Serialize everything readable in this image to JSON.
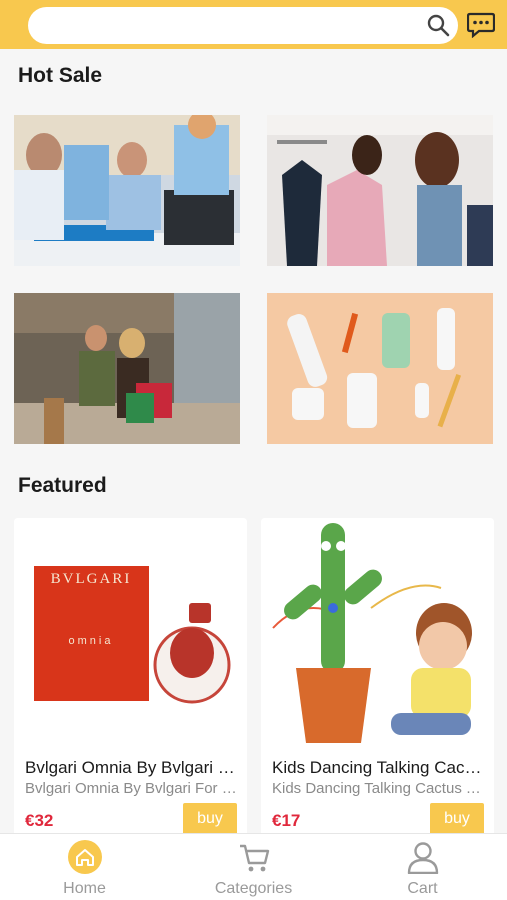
{
  "colors": {
    "accent": "#f8c84e",
    "price": "#e0283c",
    "tab_inactive": "#9a9a9a"
  },
  "search": {
    "value": "",
    "placeholder": ""
  },
  "header": {
    "search_icon": "search-icon",
    "chat_icon": "chat-icon"
  },
  "hot_sale": {
    "title": "Hot Sale",
    "tiles": [
      {
        "subject": "electronics"
      },
      {
        "subject": "fashion"
      },
      {
        "subject": "shopping"
      },
      {
        "subject": "personal-care"
      }
    ]
  },
  "featured": {
    "title": "Featured",
    "products": [
      {
        "name": "Bvlgari Omnia By Bvlgari For Women",
        "subtitle": "Bvlgari Omnia By Bvlgari For Women",
        "price": "€32",
        "buy_label": "buy",
        "brand_text": "BVLGARI",
        "product_text": "omnia"
      },
      {
        "name": "Kids Dancing Talking Cactus Toy",
        "subtitle": "Kids Dancing Talking Cactus Toy",
        "price": "€17",
        "buy_label": "buy"
      }
    ]
  },
  "tabbar": {
    "items": [
      {
        "label": "Home",
        "icon": "home-icon",
        "active": true
      },
      {
        "label": "Categories",
        "icon": "cart-icon",
        "active": false
      },
      {
        "label": "Cart",
        "icon": "user-icon",
        "active": false
      }
    ]
  }
}
